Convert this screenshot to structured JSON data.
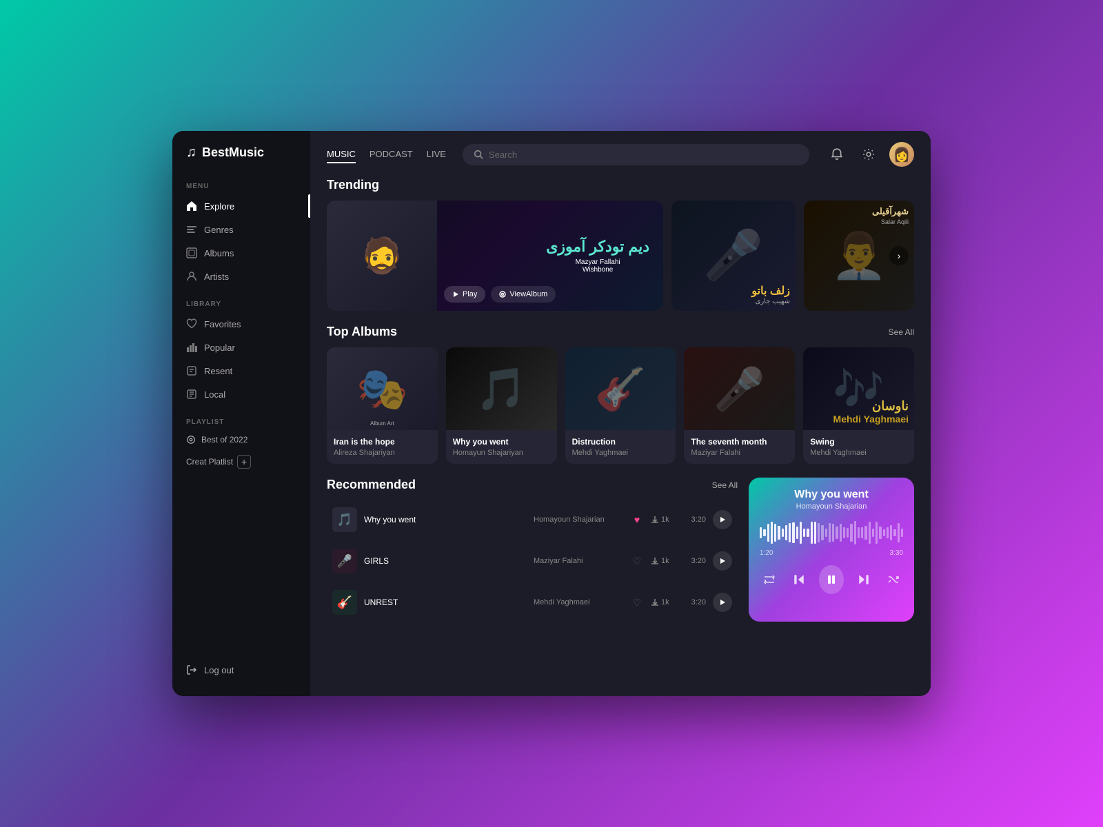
{
  "app": {
    "name": "BestMusic",
    "logo_icon": "♫"
  },
  "sidebar": {
    "menu_label": "MENU",
    "library_label": "LIBRARY",
    "playlist_label": "PLAYLIST",
    "nav_items": [
      {
        "id": "explore",
        "label": "Explore",
        "icon": "⊞",
        "active": true
      },
      {
        "id": "genres",
        "label": "Genres",
        "icon": "≡",
        "active": false
      },
      {
        "id": "albums",
        "label": "Albums",
        "icon": "⊡",
        "active": false
      },
      {
        "id": "artists",
        "label": "Artists",
        "icon": "◉",
        "active": false
      }
    ],
    "library_items": [
      {
        "id": "favorites",
        "label": "Favorites",
        "icon": "♡"
      },
      {
        "id": "popular",
        "label": "Popular",
        "icon": "↑"
      },
      {
        "id": "resent",
        "label": "Resent",
        "icon": "⊠"
      },
      {
        "id": "local",
        "label": "Local",
        "icon": "⊡"
      }
    ],
    "playlists": [
      {
        "id": "best2022",
        "label": "Best of 2022",
        "icon": "◎"
      }
    ],
    "create_playlist_label": "Creat Platlist",
    "logout_label": "Log out"
  },
  "header": {
    "tabs": [
      {
        "id": "music",
        "label": "MUSIC",
        "active": true
      },
      {
        "id": "podcast",
        "label": "PODCAST",
        "active": false
      },
      {
        "id": "live",
        "label": "LIVE",
        "active": false
      }
    ],
    "search_placeholder": "Search"
  },
  "trending": {
    "title": "Trending",
    "main": {
      "artist_name": "Mazyar Fallahi",
      "album_name": "Wishbone",
      "calligraphy": "دیم تودکر آموزی",
      "play_label": "Play",
      "view_album_label": "ViewAlbum"
    },
    "side1": {
      "calligraphy": "زلف باتو",
      "artist_arabic": "شهیب جاری"
    },
    "side2": {
      "artist_name": "Salar Aqili",
      "calligraphy": "شهرآقیلی"
    }
  },
  "top_albums": {
    "title": "Top Albums",
    "see_all_label": "See All",
    "items": [
      {
        "id": 1,
        "title": "Iran is the hope",
        "artist": "Alireza Shajariyan",
        "emoji": "🎭",
        "color": "#2a2a3a"
      },
      {
        "id": 2,
        "title": "Why you went",
        "artist": "Homayun Shajariyan",
        "emoji": "🎵",
        "color": "#1a1a1a"
      },
      {
        "id": 3,
        "title": "Distruction",
        "artist": "Mehdi Yaghmaei",
        "emoji": "🎸",
        "color": "#152030"
      },
      {
        "id": 4,
        "title": "The seventh month",
        "artist": "Maziyar Falahi",
        "emoji": "🎤",
        "color": "#2a1010"
      },
      {
        "id": 5,
        "title": "Swing",
        "artist": "Mehdi Yaghmaei",
        "emoji": "🎶",
        "color": "#10101a"
      }
    ]
  },
  "recommended": {
    "title": "Recommended",
    "see_all_label": "See All",
    "tracks": [
      {
        "id": 1,
        "name": "Why you went",
        "artist": "Homayoun Shajarian",
        "emoji": "🎵",
        "liked": true,
        "downloads": "1k",
        "duration": "3:20"
      },
      {
        "id": 2,
        "name": "GIRLS",
        "artist": "Maziyar Falahi",
        "emoji": "🎤",
        "liked": false,
        "downloads": "1k",
        "duration": "3:20"
      },
      {
        "id": 3,
        "name": "UNREST",
        "artist": "Mehdi Yaghmaei",
        "emoji": "🎸",
        "liked": false,
        "downloads": "1k",
        "duration": "3:20"
      }
    ]
  },
  "now_playing": {
    "title": "Why you went",
    "artist": "Homayoun Shajarian",
    "current_time": "1:20",
    "total_time": "3:30",
    "waveform_bars": 40,
    "active_bar_index": 15
  }
}
